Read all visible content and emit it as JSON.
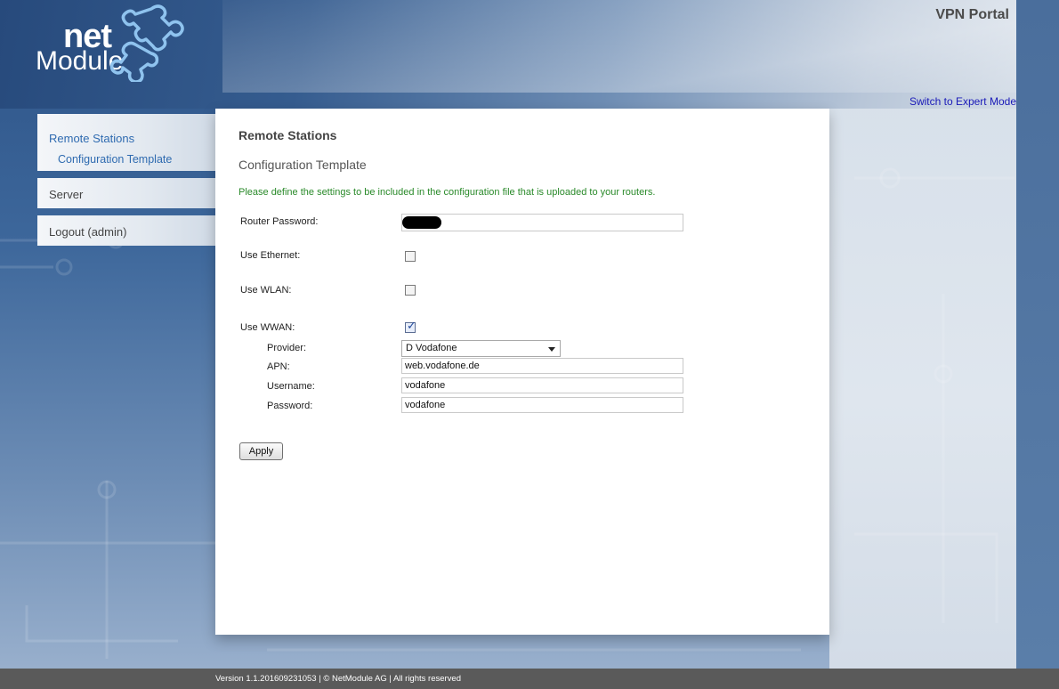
{
  "header": {
    "logo_top": "net",
    "logo_bottom": "Module",
    "portal_title": "VPN Portal",
    "expert_mode_link": "Switch to Expert Mode"
  },
  "sidebar": {
    "items": [
      {
        "label": "Remote Stations",
        "sub": "Configuration Template"
      },
      {
        "label": "Server"
      },
      {
        "label": "Logout (admin)"
      }
    ]
  },
  "main": {
    "title": "Remote Stations",
    "subtitle": "Configuration Template",
    "note": "Please define the settings to be included in the configuration file that is uploaded to your routers.",
    "form": {
      "router_password_label": "Router Password:",
      "use_ethernet_label": "Use Ethernet:",
      "use_ethernet_checked": false,
      "use_wlan_label": "Use WLAN:",
      "use_wlan_checked": false,
      "use_wwan_label": "Use WWAN:",
      "use_wwan_checked": true,
      "provider_label": "Provider:",
      "provider_value": "D Vodafone",
      "apn_label": "APN:",
      "apn_value": "web.vodafone.de",
      "username_label": "Username:",
      "username_value": "vodafone",
      "password_label": "Password:",
      "password_value": "vodafone",
      "apply_label": "Apply"
    }
  },
  "footer": {
    "text": "Version 1.1.201609231053 | © NetModule AG | All rights reserved"
  }
}
